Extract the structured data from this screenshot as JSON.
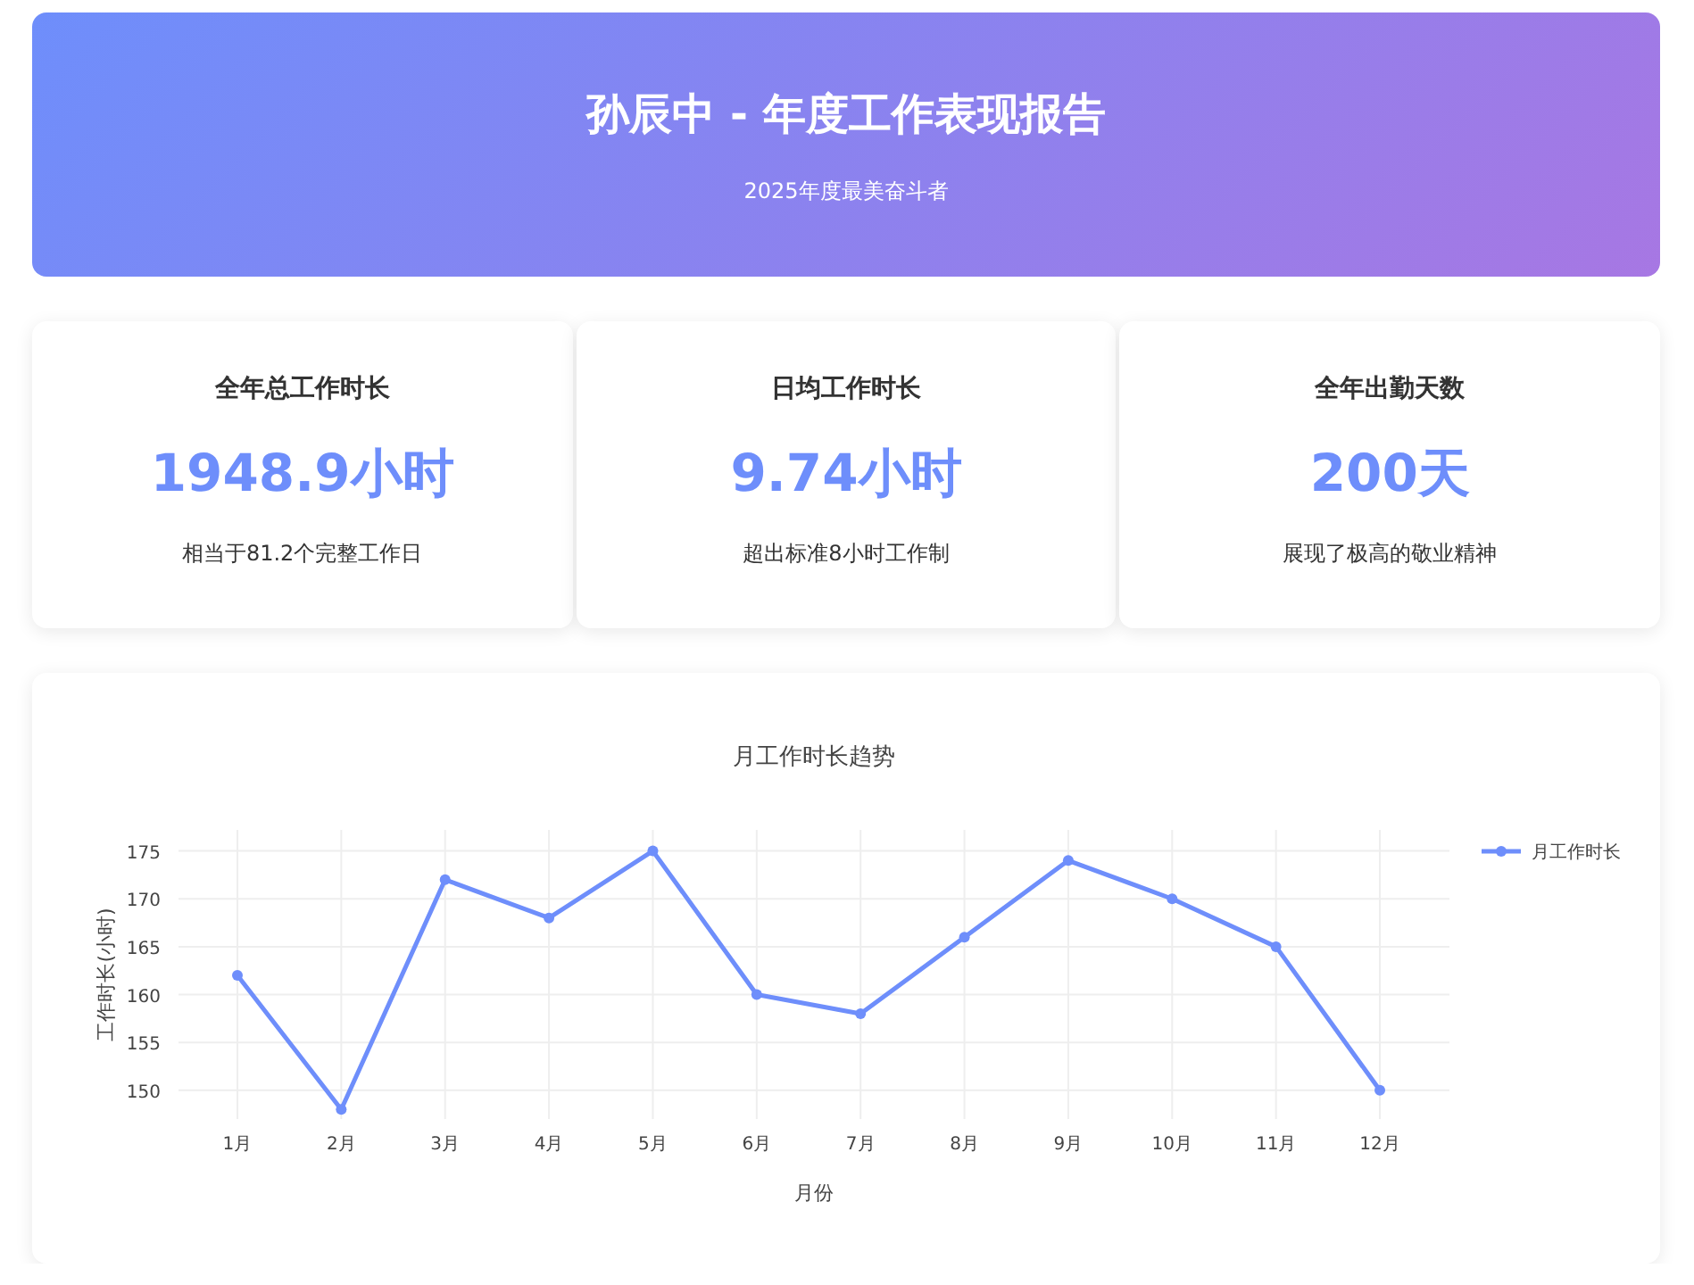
{
  "header": {
    "title": "孙辰中 - 年度工作表现报告",
    "subtitle": "2025年度最美奋斗者"
  },
  "stats": [
    {
      "label": "全年总工作时长",
      "value": "1948.9小时",
      "note": "相当于81.2个完整工作日"
    },
    {
      "label": "日均工作时长",
      "value": "9.74小时",
      "note": "超出标准8小时工作制"
    },
    {
      "label": "全年出勤天数",
      "value": "200天",
      "note": "展现了极高的敬业精神"
    }
  ],
  "chart": {
    "chart_data": {
      "type": "line",
      "title": "月工作时长趋势",
      "xlabel": "月份",
      "ylabel": "工作时长(小时)",
      "categories": [
        "1月",
        "2月",
        "3月",
        "4月",
        "5月",
        "6月",
        "7月",
        "8月",
        "9月",
        "10月",
        "11月",
        "12月"
      ],
      "grid": true,
      "series": [
        {
          "name": "月工作时长",
          "color": "#6e8efb",
          "marker": true,
          "values": [
            162,
            148,
            172,
            168,
            175,
            160,
            158,
            166,
            174,
            170,
            165,
            150
          ]
        }
      ],
      "ylim": [
        147,
        177.2
      ],
      "yticks": [
        150,
        155,
        160,
        165,
        170,
        175
      ]
    }
  }
}
